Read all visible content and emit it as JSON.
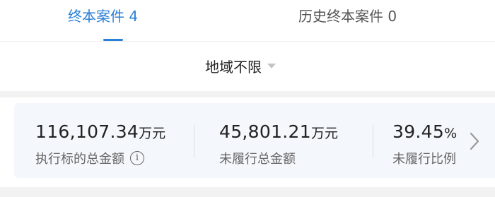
{
  "tabs": {
    "active": {
      "label": "终本案件",
      "count": "4"
    },
    "inactive": {
      "label": "历史终本案件",
      "count": "0"
    }
  },
  "filter": {
    "region_label": "地域不限"
  },
  "stats": [
    {
      "value": "116,107.34",
      "unit": "万元",
      "label": "执行标的总金额",
      "info_icon": "i"
    },
    {
      "value": "45,801.21",
      "unit": "万元",
      "label": "未履行总金额"
    },
    {
      "value": "39.45",
      "unit": "%",
      "label": "未履行比例"
    }
  ],
  "icons": [
    "info-icon",
    "caret-down-icon",
    "chevron-right-icon"
  ],
  "colors": {
    "accent": "#2a7fd6",
    "card_bg": "#f4f7fb"
  }
}
